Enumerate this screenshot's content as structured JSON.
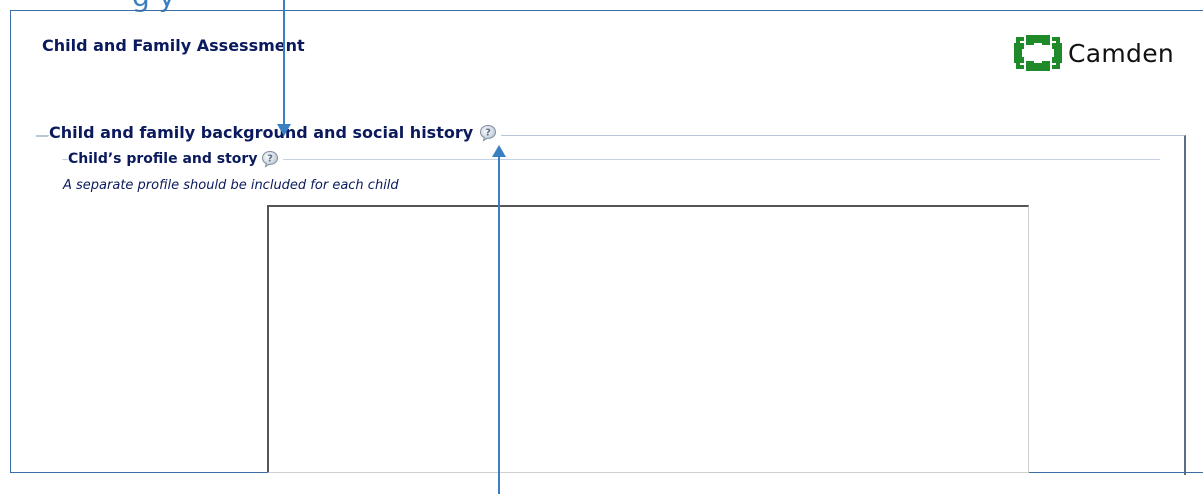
{
  "annotation_top_text": "g    y",
  "form": {
    "title": "Child and Family Assessment"
  },
  "logo": {
    "text": "Camden",
    "icon": "camden-logo-icon",
    "color": "#1f8a2a"
  },
  "section": {
    "heading": "Child and family background and social history",
    "help_icon": "help-question-icon",
    "subsection": {
      "heading": "Child’s profile and story",
      "help_icon": "help-question-icon",
      "hint": "A separate profile should be included for each child",
      "textarea_value": ""
    }
  },
  "colors": {
    "heading": "#0a1a5c",
    "annotation": "#3a7fc1",
    "frame": "#3a6ea5"
  }
}
